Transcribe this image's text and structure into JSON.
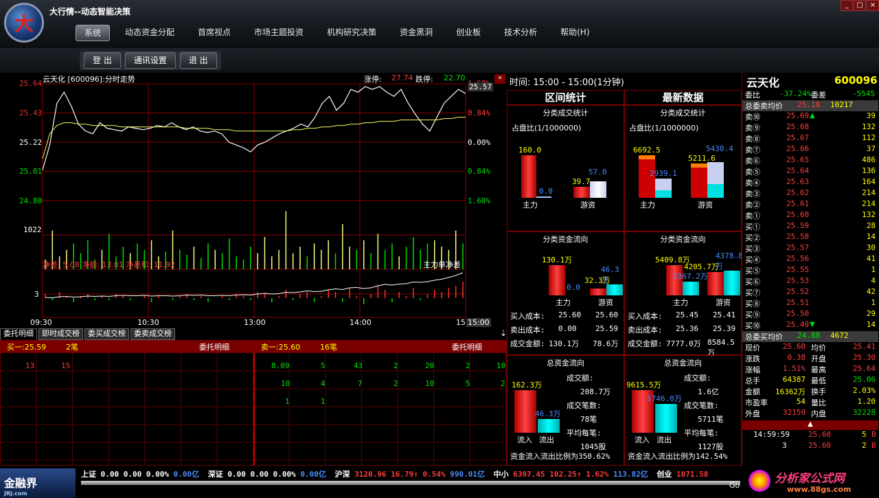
{
  "app": {
    "title": "大行情--动态智能决策",
    "logo_char": "大",
    "min": "_",
    "max": "□",
    "close": "×"
  },
  "menu": [
    "系统",
    "动态资金分配",
    "首席视点",
    "市场主题投资",
    "机构研究决策",
    "资金黑洞",
    "创业板",
    "技术分析",
    "帮助(H)"
  ],
  "toolbar": [
    "登 出",
    "通讯设置",
    "退 出"
  ],
  "chart": {
    "header": "云天化 [600096]:分时走势",
    "limit_up_label": "涨停:",
    "limit_up": "27.74",
    "limit_down_label": "跌停:",
    "limit_down": "22.70",
    "price_labels": [
      "25.64",
      "25.43",
      "25.22",
      "25.01",
      "24.80"
    ],
    "pct_labels": [
      "1.68%",
      "0.84%",
      "0.00%",
      "0.84%",
      "1.68%"
    ],
    "current_price": "25.57",
    "vol_label": "1022",
    "net_label": "净差: 5.08 净额: 13.01 净差和: 11.92",
    "main_label": "主力单净差",
    "sub_label": "3",
    "time_labels": [
      "09:30",
      "10:30",
      "13:00",
      "14:00",
      "15"
    ],
    "time_current": "15:00",
    "price_series": [
      25.02,
      25.2,
      25.5,
      25.58,
      25.48,
      25.35,
      25.3,
      25.28,
      25.36,
      25.32,
      25.31,
      25.3,
      25.33,
      25.32,
      25.31,
      25.32,
      25.34,
      25.33,
      25.36,
      25.33,
      25.31,
      25.33,
      25.3,
      25.29,
      25.3,
      25.28,
      25.22,
      25.2,
      25.18,
      25.15,
      25.2,
      25.22,
      25.25,
      25.28,
      25.3,
      25.32,
      25.35,
      25.33,
      25.4,
      25.5,
      25.55,
      25.45,
      25.5,
      25.6,
      25.58,
      25.62,
      25.6,
      25.62,
      25.58,
      25.55,
      25.6,
      25.5,
      25.42,
      25.35,
      25.3,
      25.4,
      25.5,
      25.55,
      25.6,
      25.57
    ],
    "avg_series": [
      25.1,
      25.28,
      25.34,
      25.36,
      25.36,
      25.35,
      25.35,
      25.34,
      25.34,
      25.34,
      25.34,
      25.33,
      25.33,
      25.33,
      25.33,
      25.33,
      25.33,
      25.33,
      25.33,
      25.33,
      25.32,
      25.32,
      25.32,
      25.32,
      25.31,
      25.31,
      25.31,
      25.3,
      25.3,
      25.3,
      25.3,
      25.3,
      25.3,
      25.3,
      25.3,
      25.31,
      25.31,
      25.32,
      25.32,
      25.33,
      25.33,
      25.34,
      25.34,
      25.35,
      25.35,
      25.36,
      25.36,
      25.37,
      25.37,
      25.37,
      25.38,
      25.38,
      25.38,
      25.38,
      25.38,
      25.38,
      25.39,
      25.39,
      25.4,
      25.4
    ],
    "volume_series": [
      30,
      120,
      40,
      60,
      80,
      50,
      90,
      30,
      60,
      110,
      40,
      70,
      50,
      80,
      60,
      90,
      40,
      55,
      120,
      60,
      45,
      70,
      35,
      80,
      60,
      50,
      95,
      40,
      30,
      70,
      50,
      100,
      40,
      60,
      180,
      50,
      70,
      40,
      80,
      60,
      90,
      50,
      140,
      70,
      60,
      90,
      50,
      110,
      60,
      80,
      40,
      70,
      100,
      60,
      80,
      90,
      70,
      60,
      120,
      80
    ],
    "net_series": [
      2,
      -1,
      3,
      1,
      -2,
      1,
      2,
      -1,
      1,
      -1,
      2,
      1,
      -1,
      0,
      1,
      -2,
      1,
      0,
      -1,
      1,
      2,
      -1,
      1,
      -2,
      0,
      1,
      -1,
      2,
      1,
      -1,
      3,
      2,
      -2,
      1,
      4,
      -1,
      2,
      3,
      -2,
      1,
      4,
      3,
      -2,
      5,
      1,
      -3,
      2,
      6,
      4,
      -2,
      3,
      1,
      5,
      -1,
      2,
      4,
      3,
      5,
      6,
      8
    ]
  },
  "tabs": [
    "委托明细",
    "即时成交榜",
    "委买成交榜",
    "委卖成交榜"
  ],
  "orders": {
    "buy_label": "买一:25.59",
    "buy_count": "2笔",
    "buy_title": "委托明细",
    "sell_label": "卖一:25.60",
    "sell_count": "16笔",
    "sell_title": "委托明细",
    "buy_row": [
      "13",
      "15"
    ],
    "sell_rows": [
      [
        "8.09",
        "5",
        "43",
        "2",
        "20",
        "2",
        "10"
      ],
      [
        "10",
        "4",
        "7",
        "2",
        "10",
        "5",
        "2"
      ],
      [
        "1",
        "1"
      ]
    ]
  },
  "mid": {
    "time": "时间: 15:00 - 15:00(1分钟)",
    "left_title": "区间统计",
    "right_title": "最新数据",
    "sec1_title": "分类成交统计",
    "ratio": "占盘比(1/1000000)",
    "l1": {
      "main_val": "160.0",
      "main_val2": "0.0",
      "retail_val": "39.7",
      "retail_val2": "57.0",
      "main": "主力",
      "retail": "游资"
    },
    "r1": {
      "main_val": "6692.5",
      "main_val2": "2939.1",
      "retail_val": "5211.6",
      "retail_val2": "5430.4",
      "main": "主力",
      "retail": "游资"
    },
    "sec2_title": "分类资金流向",
    "l2": {
      "main_val": "130.1万",
      "main_val2": "0.0",
      "retail_val": "32.3万",
      "retail_val2": "46.3万",
      "main": "主力",
      "retail": "游资",
      "buy_cost": "买入成本:",
      "buy_main": "25.60",
      "buy_ret": "25.60",
      "sell_cost": "卖出成本:",
      "sell_main": "0.00",
      "sell_ret": "25.59",
      "amt": "成交金额:",
      "amt_main": "130.1万",
      "amt_ret": "78.6万"
    },
    "r2": {
      "main_val": "5409.8万",
      "main_val2": "2367.2万",
      "retail_val": "4205.7万",
      "retail_val2": "4378.8万",
      "main": "主力",
      "retail": "游资",
      "buy_cost": "买入成本:",
      "buy_main": "25.45",
      "buy_ret": "25.41",
      "sell_cost": "卖出成本:",
      "sell_main": "25.36",
      "sell_ret": "25.39",
      "amt": "成交金额:",
      "amt_main": "7777.0万",
      "amt_ret": "8584.5万"
    },
    "sec3_title": "总资金流向",
    "l3": {
      "in_val": "162.3万",
      "out_val": "46.3万",
      "in": "流入",
      "out": "流出",
      "amt_lbl": "成交额:",
      "amt": "208.7万",
      "cnt_lbl": "成交笔数:",
      "cnt": "78笔",
      "avg_lbl": "平均每笔:",
      "avg": "1045股",
      "ratio": "资金流入流出比例为350.62%"
    },
    "r3": {
      "in_val": "9615.5万",
      "out_val": "5746.0万",
      "in": "流入",
      "out": "流出",
      "amt_lbl": "成交额:",
      "amt": "1.6亿",
      "cnt_lbl": "成交笔数:",
      "cnt": "5711笔",
      "avg_lbl": "平均每笔:",
      "avg": "1127股",
      "ratio": "资金流入流出比例为142.54%"
    }
  },
  "quote": {
    "name": "云天化",
    "code": "600096",
    "wb_label": "委比",
    "wb": "-37.24%",
    "wc_label": "委差",
    "wc": "-5545",
    "ask_avg_label": "总委卖均价",
    "ask_avg": "25.18",
    "ask_total": "10217",
    "asks": [
      [
        "卖⑩",
        "25.69",
        "39"
      ],
      [
        "卖⑨",
        "25.68",
        "132"
      ],
      [
        "卖⑧",
        "25.67",
        "112"
      ],
      [
        "卖⑦",
        "25.66",
        "37"
      ],
      [
        "卖⑥",
        "25.65",
        "486"
      ],
      [
        "卖⑤",
        "25.64",
        "136"
      ],
      [
        "卖④",
        "25.63",
        "164"
      ],
      [
        "卖③",
        "25.62",
        "214"
      ],
      [
        "卖②",
        "25.61",
        "214"
      ],
      [
        "卖①",
        "25.60",
        "132"
      ]
    ],
    "bids": [
      [
        "买①",
        "25.59",
        "28"
      ],
      [
        "买②",
        "25.58",
        "14"
      ],
      [
        "买③",
        "25.57",
        "30"
      ],
      [
        "买④",
        "25.56",
        "41"
      ],
      [
        "买⑤",
        "25.55",
        "1"
      ],
      [
        "买⑥",
        "25.53",
        "4"
      ],
      [
        "买⑦",
        "25.52",
        "42"
      ],
      [
        "买⑧",
        "25.51",
        "1"
      ],
      [
        "买⑨",
        "25.50",
        "29"
      ],
      [
        "买⑩",
        "25.49",
        "14"
      ]
    ],
    "bid_avg_label": "总委买均价",
    "bid_avg": "24.88",
    "bid_total": "4672",
    "stats": [
      [
        "现价",
        "25.60",
        "均价",
        "25.41"
      ],
      [
        "涨跌",
        "0.38",
        "开盘",
        "25.30"
      ],
      [
        "涨幅",
        "1.51%",
        "最高",
        "25.64"
      ],
      [
        "总手",
        "64387",
        "最低",
        "25.06"
      ],
      [
        "金额",
        "16362万",
        "换手",
        "2.03%"
      ],
      [
        "市盈率",
        "54",
        "量比",
        "1.20"
      ],
      [
        "外盘",
        "32159",
        "内盘",
        "32228"
      ]
    ],
    "ticks": [
      [
        "14:59:59",
        "25.60",
        "5",
        "B"
      ],
      [
        "3",
        "25.60",
        "2",
        "B"
      ]
    ]
  },
  "ticker": {
    "items": [
      {
        "name": "上证",
        "v1": "0.00",
        "v2": "0.00",
        "pct": "0.00%",
        "amt": "0.00亿"
      },
      {
        "name": "深证",
        "v1": "0.00",
        "v2": "0.00",
        "pct": "0.00%",
        "amt": "0.00亿"
      },
      {
        "name": "沪深",
        "v1": "3120.96",
        "v2": "16.79↑",
        "pct": "0.54%",
        "amt": "990.01亿"
      },
      {
        "name": "中小",
        "v1": "6397.45",
        "v2": "102.25↑",
        "pct": "1.62%",
        "amt": "113.82亿"
      },
      {
        "name": "创业",
        "v1": "1071.58",
        "v2": "",
        "pct": "",
        "amt": ""
      }
    ],
    "brand_left": "金融界",
    "brand_left_sub": "JRJ.com",
    "brand_right": "分析家公式网",
    "brand_right_url": "www.88gs.com",
    "goo": "Goo"
  }
}
